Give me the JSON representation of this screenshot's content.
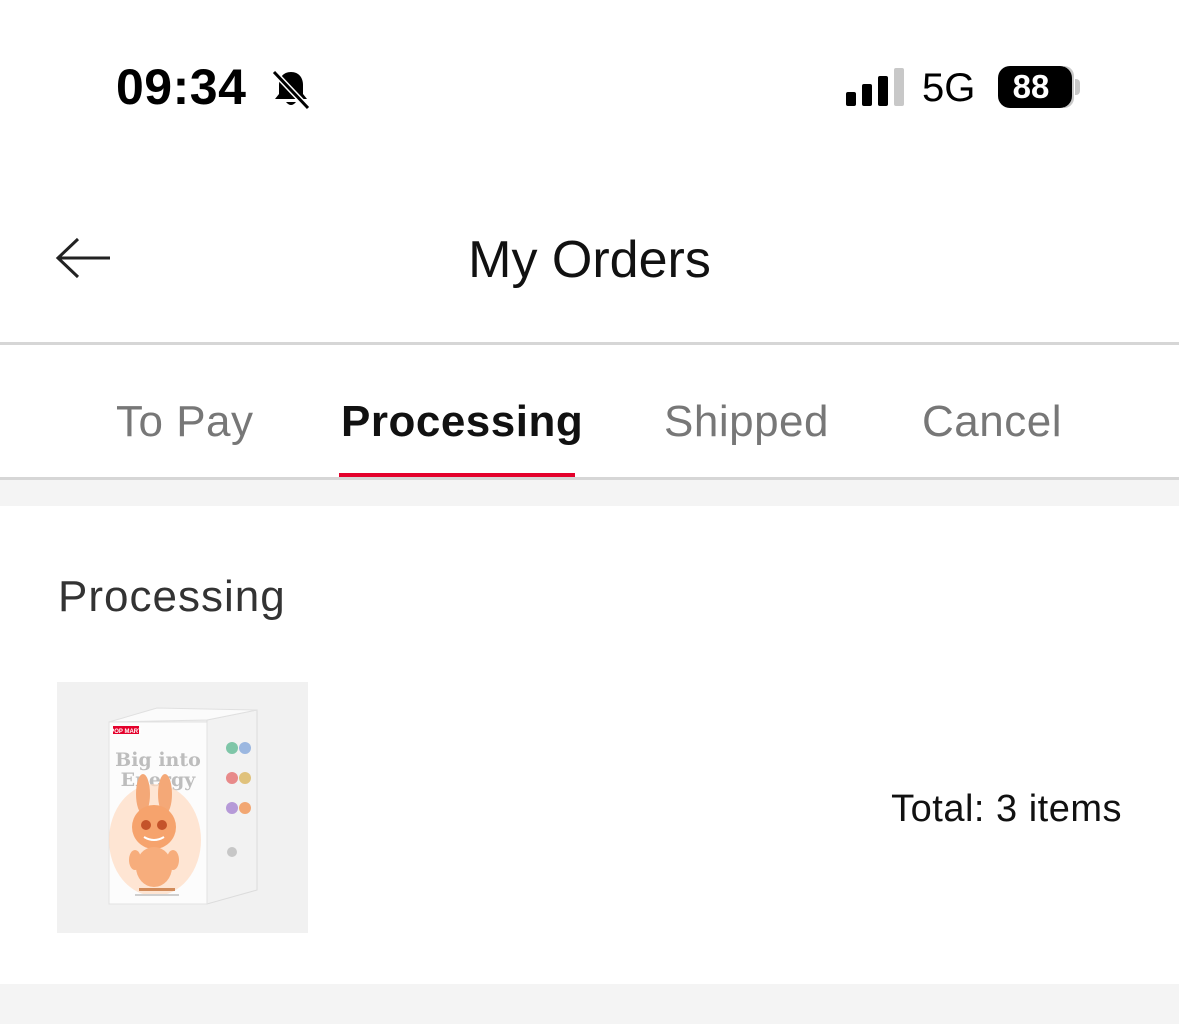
{
  "status_bar": {
    "time": "09:34",
    "network": "5G",
    "battery_level": "88",
    "icons": [
      "bell-slash-icon",
      "signal-bars-icon",
      "battery-icon"
    ]
  },
  "header": {
    "title": "My Orders",
    "back_icon": "arrow-left-icon"
  },
  "tabs": [
    {
      "label": "To Pay",
      "active": false
    },
    {
      "label": "Processing",
      "active": true
    },
    {
      "label": "Shipped",
      "active": false
    },
    {
      "label": "Cancel",
      "active": false
    }
  ],
  "colors": {
    "accent": "#e4002b",
    "divider": "#d6d6d6",
    "background_gap": "#f4f4f4"
  },
  "order": {
    "status": "Processing",
    "total_label": "Total: 3 items",
    "product_image": {
      "brand_text": "POP MART",
      "box_title_line1": "Big into",
      "box_title_line2": "Energy"
    }
  }
}
